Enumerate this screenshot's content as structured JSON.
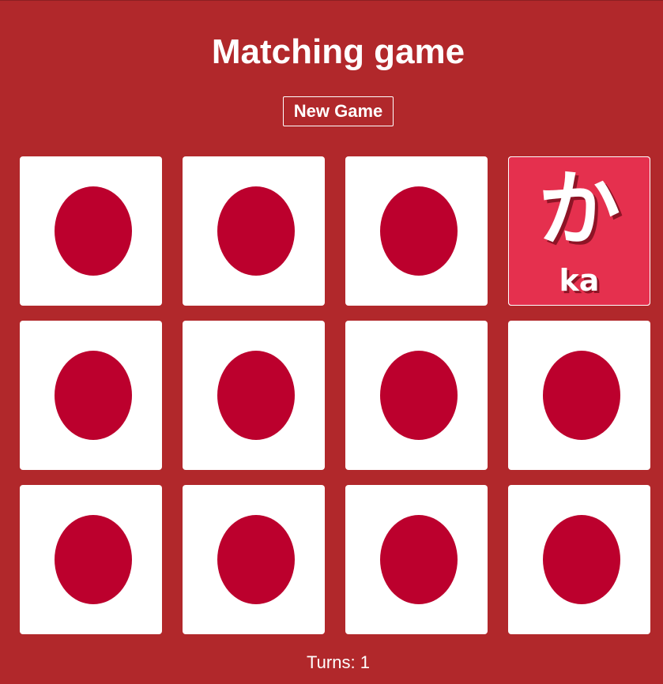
{
  "title": "Matching game",
  "new_game_label": "New Game",
  "turns_label": "Turns: 1",
  "colors": {
    "background": "#b1282b",
    "card_back": "#ffffff",
    "card_dot": "#bc002d",
    "card_face": "#e5304e"
  },
  "cards": [
    {
      "flipped": false,
      "kana": "",
      "romaji": ""
    },
    {
      "flipped": false,
      "kana": "",
      "romaji": ""
    },
    {
      "flipped": false,
      "kana": "",
      "romaji": ""
    },
    {
      "flipped": true,
      "kana": "か",
      "romaji": "ka"
    },
    {
      "flipped": false,
      "kana": "",
      "romaji": ""
    },
    {
      "flipped": false,
      "kana": "",
      "romaji": ""
    },
    {
      "flipped": false,
      "kana": "",
      "romaji": ""
    },
    {
      "flipped": false,
      "kana": "",
      "romaji": ""
    },
    {
      "flipped": false,
      "kana": "",
      "romaji": ""
    },
    {
      "flipped": false,
      "kana": "",
      "romaji": ""
    },
    {
      "flipped": false,
      "kana": "",
      "romaji": ""
    },
    {
      "flipped": false,
      "kana": "",
      "romaji": ""
    }
  ]
}
